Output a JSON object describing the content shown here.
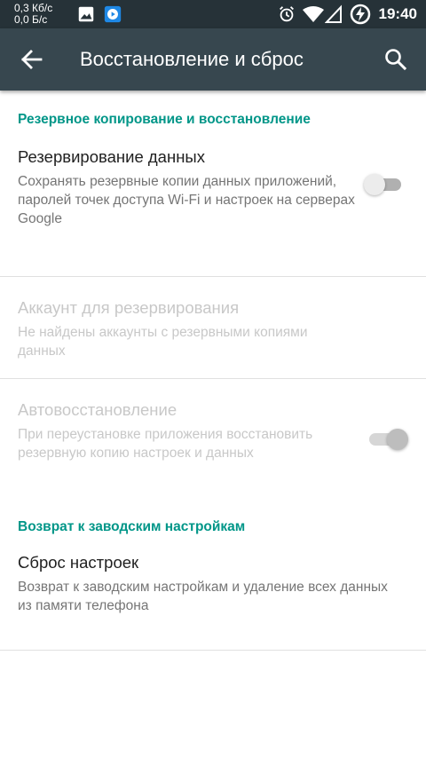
{
  "status_bar": {
    "net_speed_up": "0,3 Кб/с",
    "net_speed_down": "0,0 Б/с",
    "time": "19:40",
    "icons": [
      "image-icon",
      "play-app-icon",
      "alarm-icon",
      "wifi-icon",
      "signal-icon",
      "battery-charging-icon"
    ]
  },
  "app_bar": {
    "back_icon": "arrow-back-icon",
    "title": "Восстановление и сброс",
    "search_icon": "search-icon"
  },
  "sections": {
    "backup_header": "Резервное копирование и восстановление",
    "reset_header": "Возврат к заводским настройкам"
  },
  "prefs": {
    "backup_data": {
      "title": "Резервирование данных",
      "summary": "Сохранять резервные копии данных приложений, паролей точек доступа Wi-Fi и настроек на серверах Google",
      "enabled": true,
      "switch_on": false
    },
    "backup_account": {
      "title": "Аккаунт для резервирования",
      "summary": "Не найдены аккаунты с резервными копиями данных",
      "enabled": false
    },
    "auto_restore": {
      "title": "Автовосстановление",
      "summary": "При переустановке приложения восстановить резервную копию настроек и данных",
      "enabled": false,
      "switch_on": true
    },
    "factory_reset": {
      "title": "Сброс настроек",
      "summary": "Возврат к заводским настройкам и удаление всех данных из памяти телефона",
      "enabled": true
    }
  },
  "colors": {
    "status_bar": "#263238",
    "app_bar": "#37474f",
    "accent": "#009688",
    "switch_off_track": "#b0b0b0",
    "switch_off_thumb": "#ececec",
    "switch_disabled_track": "#d6d6d6",
    "switch_disabled_thumb": "#bdbdbd"
  }
}
